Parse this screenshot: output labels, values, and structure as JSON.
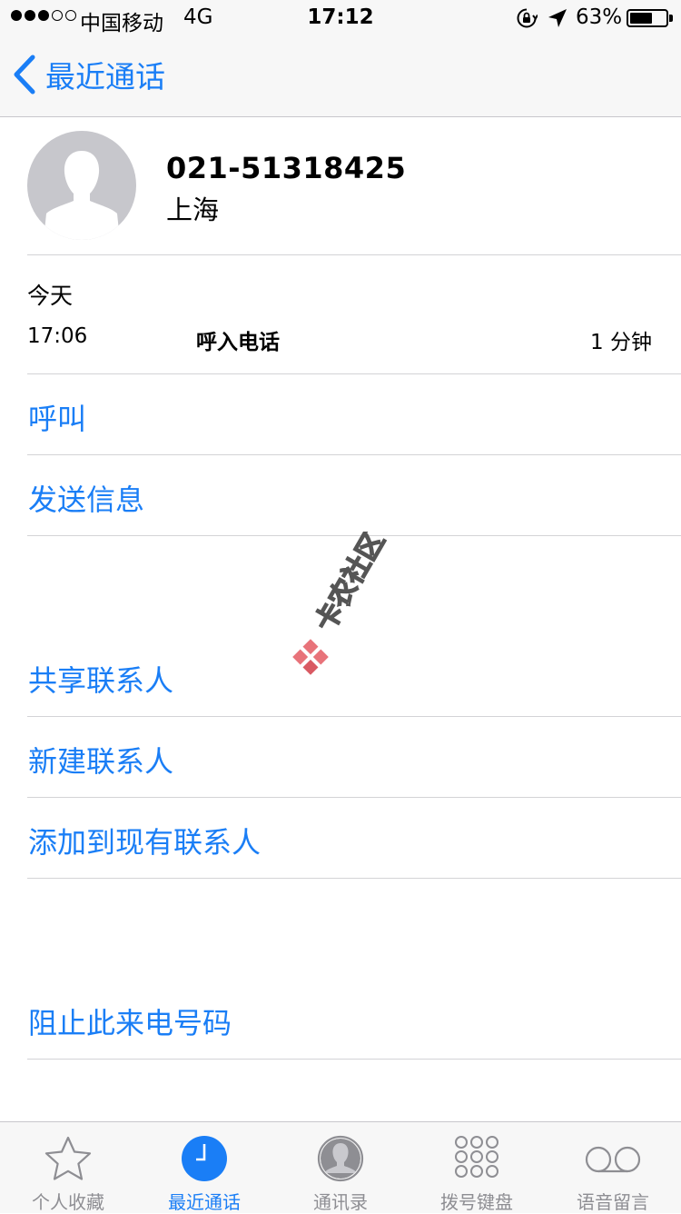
{
  "status_bar": {
    "carrier": "中国移动",
    "network": "4G",
    "time": "17:12",
    "battery_percent": "63%",
    "battery_level": 0.63,
    "icons": [
      "signal-dots-icon",
      "rotation-lock-icon",
      "location-arrow-icon",
      "battery-icon"
    ]
  },
  "nav": {
    "back_label": "最近通话",
    "back_icon": "chevron-left-icon"
  },
  "contact": {
    "number": "021-51318425",
    "location": "上海",
    "avatar_icon": "person-silhouette-icon"
  },
  "call_log": {
    "day": "今天",
    "time": "17:06",
    "type": "呼入电话",
    "duration": "1 分钟"
  },
  "actions": {
    "call": "呼叫",
    "message": "发送信息",
    "share": "共享联系人",
    "new_contact": "新建联系人",
    "add_existing": "添加到现有联系人",
    "block": "阻止此来电号码"
  },
  "watermark": {
    "text": "卡农社区"
  },
  "tabs": [
    {
      "label": "个人收藏",
      "icon": "star-icon"
    },
    {
      "label": "最近通话",
      "icon": "clock-icon",
      "active": true
    },
    {
      "label": "通讯录",
      "icon": "contacts-icon"
    },
    {
      "label": "拨号键盘",
      "icon": "keypad-icon"
    },
    {
      "label": "语音留言",
      "icon": "voicemail-icon"
    }
  ],
  "colors": {
    "accent": "#1a7ef6",
    "bar_background": "#f7f7f7",
    "separator": "#d3d3d6",
    "inactive_tab": "#8e8e93"
  }
}
